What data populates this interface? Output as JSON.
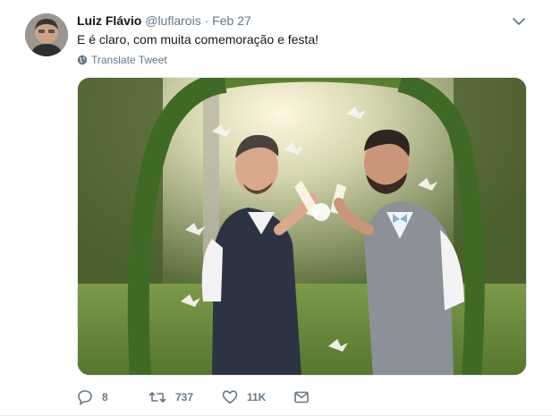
{
  "tweet": {
    "author_name": "Luiz Flávio",
    "handle": "@luflarois",
    "separator": "·",
    "date": "Feb 27",
    "text": "E é claro, com muita comemoração e festa!",
    "translate_label": "Translate Tweet"
  },
  "actions": {
    "reply_count": "8",
    "retweet_count": "737",
    "like_count": "11K"
  },
  "icons": [
    "more-caret-icon",
    "globe-icon",
    "reply-icon",
    "retweet-icon",
    "like-icon",
    "dm-icon"
  ],
  "colors": {
    "text_primary": "#14171a",
    "text_secondary": "#657786",
    "border": "#e6ecf0"
  }
}
